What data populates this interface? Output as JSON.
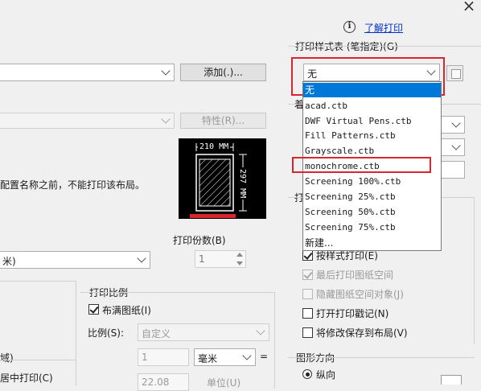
{
  "header": {
    "info_icon": "i",
    "help_link": "了解打印",
    "close": "×"
  },
  "printer": {
    "add_button": "添加(.)...",
    "properties_button": "特性(R)...",
    "layout_notice": "配置名称之前，不能打印该布局。"
  },
  "paper_preview": {
    "width_label": "210 MM",
    "height_label": "297 MM"
  },
  "paper_size_combo": "米)",
  "copies": {
    "label": "打印份数(B)",
    "value": "1"
  },
  "scale": {
    "group_label": "打印比例",
    "fit_label": "布满图纸(I)",
    "fit_checked": true,
    "ratio_label": "比例(S):",
    "ratio_value": "自定义",
    "value1": "1",
    "unit": "毫米",
    "equals": "=",
    "value2": "22.08",
    "unit2": "单位(U)"
  },
  "left_fragments": {
    "area_label": "域)",
    "center_label": "居中打印(C)"
  },
  "style_table": {
    "label": "打印样式表 (笔指定)(G)",
    "value": "无",
    "options": [
      "无",
      "acad.ctb",
      "DWF Virtual Pens.ctb",
      "Fill Patterns.ctb",
      "Grayscale.ctb",
      "monochrome.ctb",
      "Screening 100%.ctb",
      "Screening 25%.ctb",
      "Screening 50%.ctb",
      "Screening 75%.ctb",
      "新建..."
    ]
  },
  "right_fragments": {
    "shaded_label": "着",
    "options_label": "打"
  },
  "plot_options": [
    {
      "label": "按样式打印(E)",
      "checked": true,
      "disabled": false
    },
    {
      "label": "最后打印图纸空间",
      "checked": true,
      "disabled": true
    },
    {
      "label": "隐藏图纸空间对象(J)",
      "checked": false,
      "disabled": true
    },
    {
      "label": "打开打印戳记(N)",
      "checked": false,
      "disabled": false
    },
    {
      "label": "将修改保存到布局(V)",
      "checked": false,
      "disabled": false
    }
  ],
  "orientation": {
    "label": "图形方向",
    "portrait": "纵向"
  },
  "colors": {
    "highlight": "#d9262e",
    "selection": "#0078d7"
  }
}
